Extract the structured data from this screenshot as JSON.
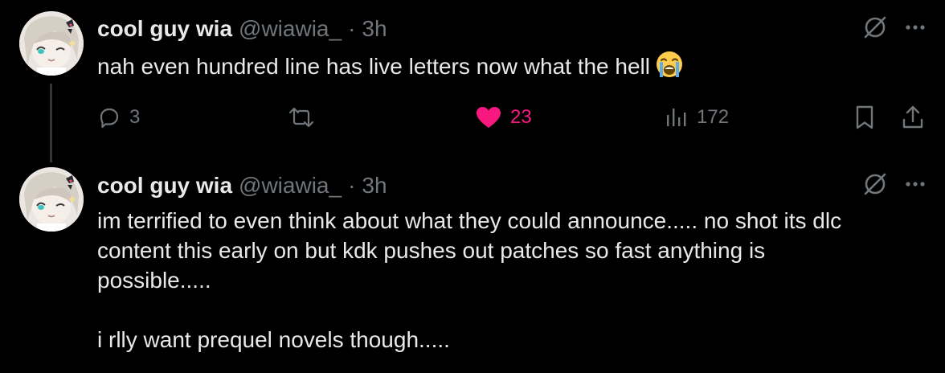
{
  "tweets": [
    {
      "display_name": "cool guy wia",
      "handle": "@wiawia_",
      "separator": "·",
      "time": "3h",
      "text": "nah even hundred line has live letters now what the hell",
      "emoji": "loudly-crying-face"
    },
    {
      "display_name": "cool guy wia",
      "handle": "@wiawia_",
      "separator": "·",
      "time": "3h",
      "text": "im terrified to even think about what they could announce..... no shot its dlc\ncontent this early on but kdk pushes out patches so fast anything is\npossible.....\n\ni rlly want prequel novels though....."
    }
  ],
  "actions": {
    "reply_count": "3",
    "like_count": "23",
    "view_count": "172",
    "liked": true
  },
  "colors": {
    "background": "#000000",
    "text": "#e7e9ea",
    "secondary": "#71767b",
    "like": "#f91880",
    "thread_line": "#333639"
  },
  "icons": {
    "grok": "grok-icon",
    "more": "more-icon",
    "reply": "reply-icon",
    "retweet": "retweet-icon",
    "like": "heart-icon",
    "views": "views-icon",
    "bookmark": "bookmark-icon",
    "share": "share-icon"
  }
}
